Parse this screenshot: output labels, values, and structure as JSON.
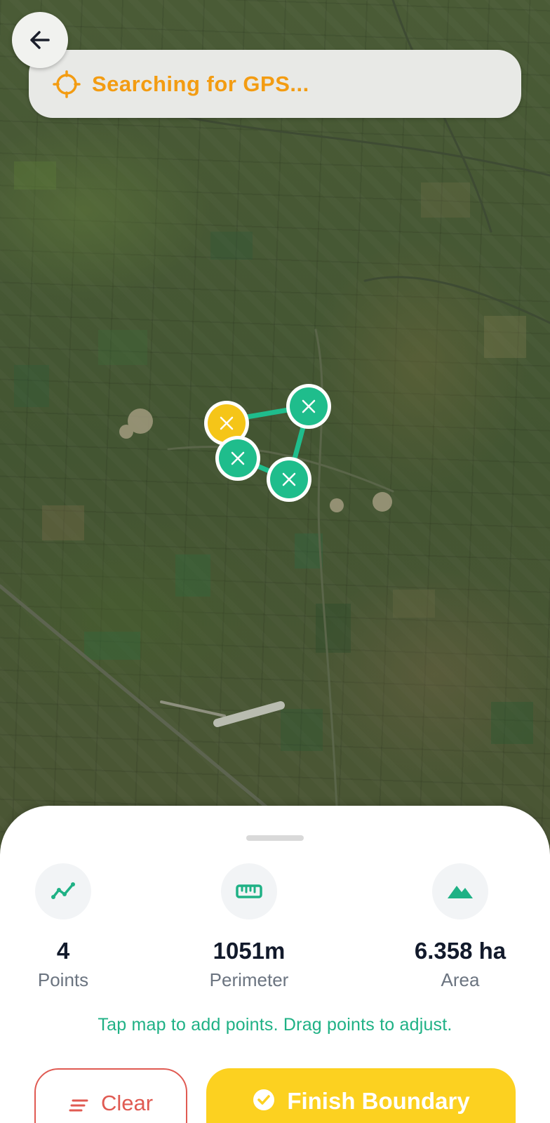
{
  "header": {
    "back_icon": "arrow-left-icon",
    "gps_status": "Searching for GPS...",
    "gps_icon": "crosshair-icon",
    "gps_color": "#f39c12"
  },
  "map": {
    "boundary_color": "#1fbd8c",
    "first_point_color": "#f5c518",
    "points": [
      {
        "id": 1,
        "first": true
      },
      {
        "id": 2,
        "first": false
      },
      {
        "id": 3,
        "first": false
      },
      {
        "id": 4,
        "first": false
      }
    ]
  },
  "stats": {
    "points": {
      "icon": "trend-line-icon",
      "value": "4",
      "label": "Points"
    },
    "perimeter": {
      "icon": "ruler-icon",
      "value": "1051m",
      "label": "Perimeter"
    },
    "area": {
      "icon": "mountain-icon",
      "value": "6.358 ha",
      "label": "Area"
    }
  },
  "hint": "Tap map to add points. Drag points to adjust.",
  "actions": {
    "clear_label": "Clear",
    "clear_icon": "clear-list-icon",
    "finish_label": "Finish Boundary",
    "finish_icon": "check-circle-icon",
    "clear_color": "#e05a52",
    "finish_color": "#fcd120"
  }
}
